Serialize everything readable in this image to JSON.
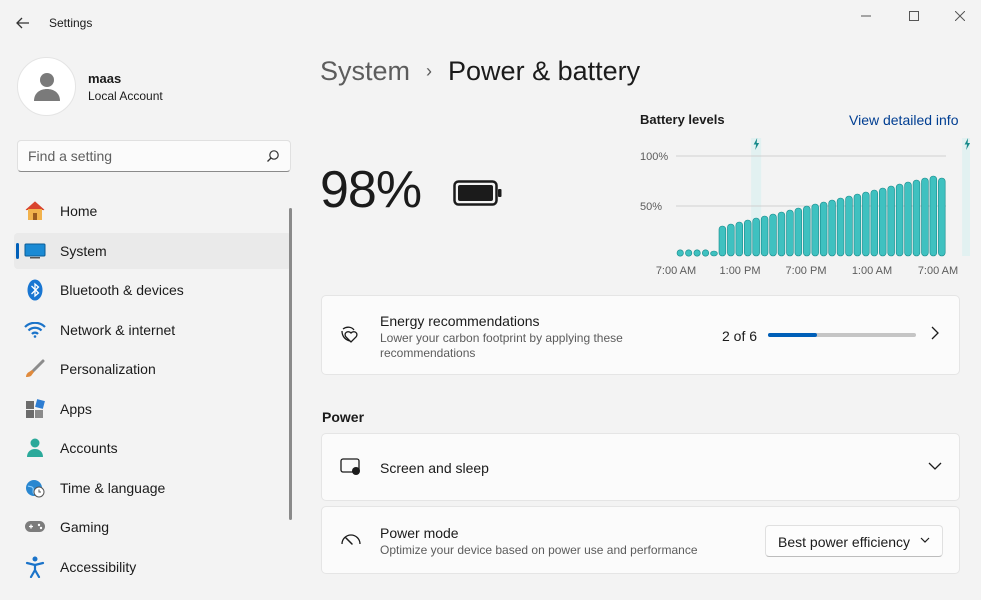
{
  "window": {
    "title": "Settings",
    "minimize": "—",
    "maximize": "☐",
    "close": "✕"
  },
  "profile": {
    "name": "maas",
    "account_type": "Local Account"
  },
  "search": {
    "placeholder": "Find a setting"
  },
  "sidebar": {
    "items": [
      {
        "label": "Home",
        "icon": "home-icon",
        "active": false
      },
      {
        "label": "System",
        "icon": "monitor-icon",
        "active": true
      },
      {
        "label": "Bluetooth & devices",
        "icon": "bluetooth-icon",
        "active": false
      },
      {
        "label": "Network & internet",
        "icon": "wifi-icon",
        "active": false
      },
      {
        "label": "Personalization",
        "icon": "brush-icon",
        "active": false
      },
      {
        "label": "Apps",
        "icon": "apps-icon",
        "active": false
      },
      {
        "label": "Accounts",
        "icon": "person-icon",
        "active": false
      },
      {
        "label": "Time & language",
        "icon": "globe-clock-icon",
        "active": false
      },
      {
        "label": "Gaming",
        "icon": "gamepad-icon",
        "active": false
      },
      {
        "label": "Accessibility",
        "icon": "accessibility-icon",
        "active": false
      }
    ]
  },
  "breadcrumb": {
    "parent": "System",
    "separator": "›",
    "current": "Power & battery"
  },
  "battery": {
    "percent": "98%"
  },
  "chart_data": {
    "type": "bar",
    "title": "Battery levels",
    "link": "View detailed info",
    "y_ticks": [
      "100%",
      "50%"
    ],
    "ylim": [
      0,
      100
    ],
    "x_ticks": [
      "7:00 AM",
      "1:00 PM",
      "7:00 PM",
      "1:00 AM",
      "7:00 AM"
    ],
    "charging_markers": [
      9,
      34
    ],
    "values": [
      2,
      2,
      2,
      2,
      5,
      30,
      32,
      34,
      36,
      38,
      40,
      42,
      44,
      46,
      48,
      50,
      52,
      54,
      56,
      58,
      60,
      62,
      64,
      66,
      68,
      70,
      72,
      74,
      76,
      78,
      80,
      78
    ],
    "bar_start_index": 4,
    "colors": {
      "bar": "#3fc1c0",
      "bar_border": "#168a8a",
      "highlight": "#e2f1f1",
      "grid": "#d0d0d0"
    }
  },
  "energy": {
    "title": "Energy recommendations",
    "subtitle": "Lower your carbon footprint by applying these recommendations",
    "count": "2 of 6",
    "progress": 0.333
  },
  "power_section": {
    "heading": "Power",
    "screen_sleep": "Screen and sleep",
    "power_mode_title": "Power mode",
    "power_mode_sub": "Optimize your device based on power use and performance",
    "power_mode_value": "Best power efficiency"
  },
  "colors": {
    "accent": "#005fb8",
    "background": "#f3f3f3",
    "card": "#fbfbfb"
  }
}
